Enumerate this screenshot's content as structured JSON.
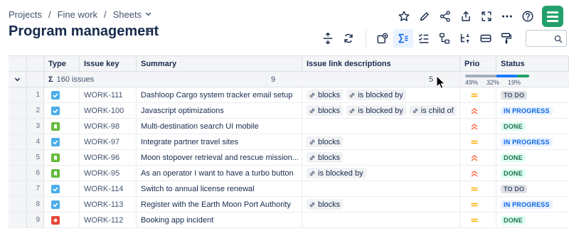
{
  "breadcrumb": {
    "items": [
      "Projects",
      "Fine work",
      "Sheets"
    ],
    "separator": "/"
  },
  "page": {
    "title": "Program management"
  },
  "columns": {
    "type": "Type",
    "key": "Issue key",
    "summary": "Summary",
    "links": "Issue link descriptions",
    "priority": "Prio",
    "status": "Status"
  },
  "summary_row": {
    "sigma": "Σ",
    "issues": "160 issues",
    "links_count": "9",
    "prio_count": "5",
    "status_pcts": [
      "49%",
      "32%",
      "19%"
    ],
    "status_fractions": [
      0.49,
      0.32,
      0.19
    ],
    "status_colors": [
      "#a5adba",
      "#1d7afc",
      "#22a06b"
    ]
  },
  "colors": {
    "brand_green": "#22a06b",
    "task_blue": "#4bade8",
    "story_green": "#63ba3c",
    "bug_red": "#e5493a",
    "prio_medium": "#ffab00",
    "prio_high": "#ff7452",
    "active_tool": "#e9f2ff"
  },
  "statuses": {
    "todo": {
      "label": "TO DO",
      "bg": "#dfe1e6",
      "fg": "#44546f"
    },
    "inprogress": {
      "label": "IN PROGRESS",
      "bg": "#e9f2ff",
      "fg": "#0c66e4"
    },
    "done": {
      "label": "DONE",
      "bg": "#dcfff1",
      "fg": "#216e4e"
    }
  },
  "rows": [
    {
      "num": "1",
      "type": "task",
      "key": "WORK-111",
      "summary": "Dashloop Cargo system tracker email setup",
      "links": [
        "blocks",
        "is blocked by"
      ],
      "priority": "medium",
      "status": "todo"
    },
    {
      "num": "2",
      "type": "task",
      "key": "WORK-100",
      "summary": "Javascript optimizations",
      "links": [
        "blocks",
        "is blocked by",
        "is child of"
      ],
      "priority": "high",
      "status": "inprogress"
    },
    {
      "num": "3",
      "type": "story",
      "key": "WORK-98",
      "summary": "Multi-destination search UI mobile",
      "links": [],
      "priority": "high",
      "status": "done"
    },
    {
      "num": "4",
      "type": "task",
      "key": "WORK-97",
      "summary": "Integrate partner travel sites",
      "links": [
        "blocks"
      ],
      "priority": "medium",
      "status": "inprogress"
    },
    {
      "num": "5",
      "type": "story",
      "key": "WORK-96",
      "summary": "Moon stopover retrieval and rescue mission...",
      "links": [
        "blocks"
      ],
      "priority": "high",
      "status": "done"
    },
    {
      "num": "6",
      "type": "story",
      "key": "WORK-95",
      "summary": "As an operator I want to have a turbo button",
      "links": [
        "is blocked by"
      ],
      "priority": "high",
      "status": "done"
    },
    {
      "num": "7",
      "type": "task",
      "key": "WORK-114",
      "summary": "Switch to annual license renewal",
      "links": [],
      "priority": "medium",
      "status": "todo"
    },
    {
      "num": "8",
      "type": "task",
      "key": "WORK-113",
      "summary": "Register with the Earth Moon Port Authority",
      "links": [
        "blocks"
      ],
      "priority": "medium",
      "status": "inprogress"
    },
    {
      "num": "9",
      "type": "bug",
      "key": "WORK-112",
      "summary": "Booking app incident",
      "links": [],
      "priority": "medium",
      "status": "done"
    }
  ],
  "icons": {
    "top_actions": [
      "star-icon",
      "edit-icon",
      "share-icon",
      "export-icon",
      "fullscreen-icon",
      "more-icon",
      "help-icon",
      "app-logo"
    ],
    "toolbar": [
      "row-height-icon",
      "refresh-icon",
      "add-view-icon",
      "sum-icon",
      "checklist-icon",
      "hierarchy-icon",
      "tree-sort-icon",
      "card-icon",
      "format-paint-icon",
      "search-icon"
    ]
  }
}
